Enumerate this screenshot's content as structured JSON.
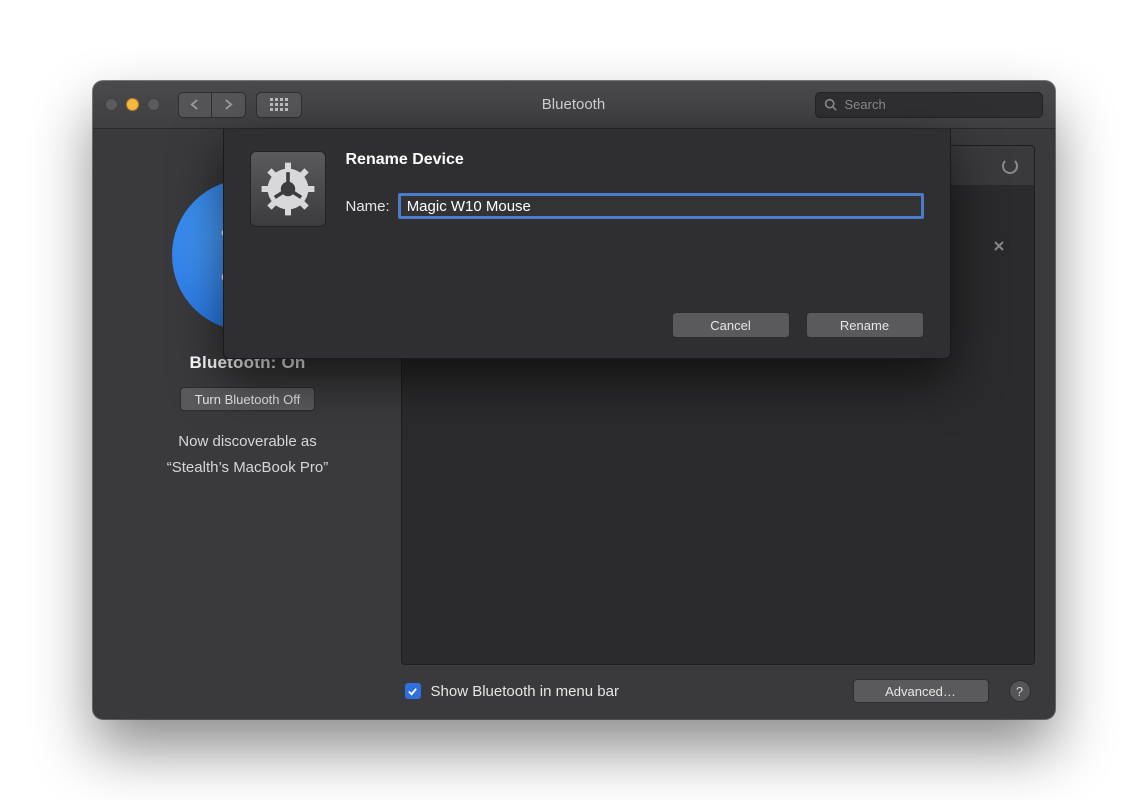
{
  "window": {
    "title": "Bluetooth",
    "search_placeholder": "Search"
  },
  "left": {
    "status_label": "Bluetooth: On",
    "toggle_button": "Turn Bluetooth Off",
    "discoverable_line1": "Now discoverable as",
    "discoverable_line2": "“Stealth’s MacBook Pro”"
  },
  "bottom": {
    "show_in_menubar_checked": true,
    "show_in_menubar_label": "Show Bluetooth in menu bar",
    "advanced_button": "Advanced…",
    "help_label": "?"
  },
  "sheet": {
    "title": "Rename Device",
    "name_label": "Name:",
    "name_value": "Magic W10 Mouse",
    "cancel_label": "Cancel",
    "rename_label": "Rename"
  },
  "icons": {
    "back": "chevron-left-icon",
    "forward": "chevron-right-icon",
    "grid": "grid-icon",
    "search": "search-icon",
    "bluetooth": "bluetooth-icon",
    "spinner": "spinner-icon",
    "close_x": "close-icon",
    "checkbox": "checkbox-checked-icon",
    "gear": "gear-icon"
  }
}
